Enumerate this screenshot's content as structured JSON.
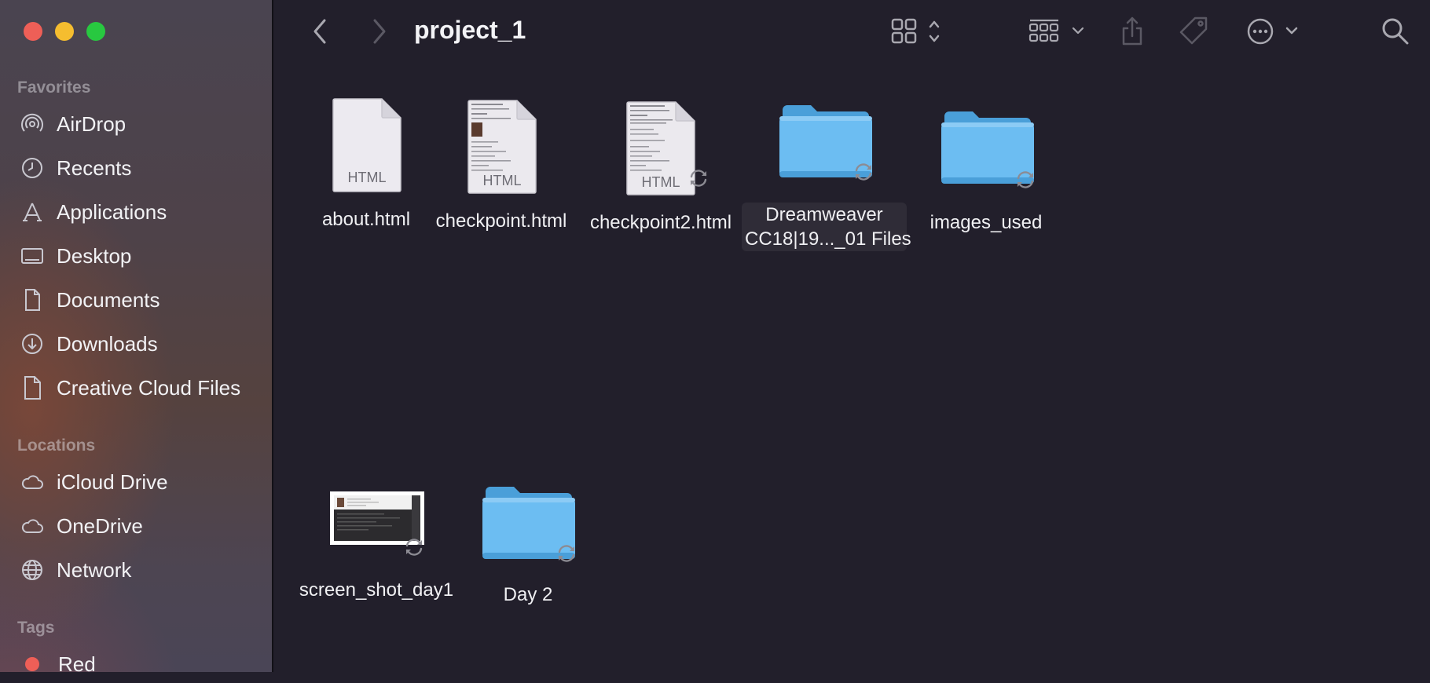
{
  "window": {
    "title": "project_1"
  },
  "sidebar": {
    "favorites_title": "Favorites",
    "favorites": [
      {
        "label": "AirDrop",
        "icon": "airdrop-icon"
      },
      {
        "label": "Recents",
        "icon": "clock-icon"
      },
      {
        "label": "Applications",
        "icon": "applications-icon"
      },
      {
        "label": "Desktop",
        "icon": "desktop-icon"
      },
      {
        "label": "Documents",
        "icon": "document-icon"
      },
      {
        "label": "Downloads",
        "icon": "download-icon"
      },
      {
        "label": "Creative Cloud Files",
        "icon": "file-icon"
      }
    ],
    "locations_title": "Locations",
    "locations": [
      {
        "label": "iCloud Drive",
        "icon": "cloud-icon"
      },
      {
        "label": "OneDrive",
        "icon": "cloud-icon"
      },
      {
        "label": "Network",
        "icon": "globe-icon"
      }
    ],
    "tags_title": "Tags",
    "tags": [
      {
        "label": "Red",
        "color": "#ee5f57"
      }
    ]
  },
  "files": [
    {
      "name": "about.html",
      "kind": "html-document",
      "badge": "HTML"
    },
    {
      "name": "checkpoint.html",
      "kind": "html-document-preview",
      "badge": "HTML"
    },
    {
      "name": "checkpoint2.html",
      "kind": "html-document-preview",
      "badge": "HTML",
      "syncing": true
    },
    {
      "name_line1": "Dreamweaver",
      "name_line2": "CC18|19..._01 Files",
      "kind": "folder",
      "syncing": true
    },
    {
      "name": "images_used",
      "kind": "folder",
      "syncing": true
    },
    {
      "name": "screen_shot_day1",
      "kind": "image",
      "syncing": true
    },
    {
      "name": "Day 2",
      "kind": "folder",
      "syncing": true
    }
  ],
  "colors": {
    "folder": "#6cbdf2",
    "folder_dark": "#4a9fd9",
    "background": "#221f2b"
  }
}
